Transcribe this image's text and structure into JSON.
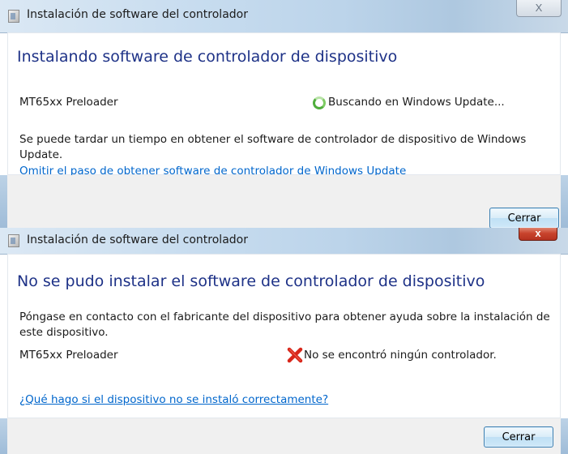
{
  "dialog1": {
    "title": "Instalación de software del controlador",
    "close_glyph": "X",
    "heading": "Instalando software de controlador de dispositivo",
    "device_name": "MT65xx Preloader",
    "status": "Buscando en Windows Update...",
    "status_icon": "spinner-icon",
    "message": "Se puede tardar un tiempo en obtener el software de controlador de dispositivo de Windows Update.",
    "link": "Omitir el paso de obtener software de controlador de Windows Update",
    "close_button": "Cerrar"
  },
  "dialog2": {
    "title": "Instalación de software del controlador",
    "close_glyph": "x",
    "heading": "No se pudo instalar el software de controlador de dispositivo",
    "message": "Póngase en contacto con el fabricante del dispositivo para obtener ayuda sobre la instalación de este dispositivo.",
    "device_name": "MT65xx Preloader",
    "status": "No se encontró ningún controlador.",
    "status_icon": "error-x-icon",
    "link": "¿Qué hago si el dispositivo no se instaló correctamente?",
    "close_button": "Cerrar"
  },
  "colors": {
    "heading": "#1e3287",
    "link": "#0066cc",
    "error": "#d8261a",
    "spinner": "#4fae3c"
  }
}
